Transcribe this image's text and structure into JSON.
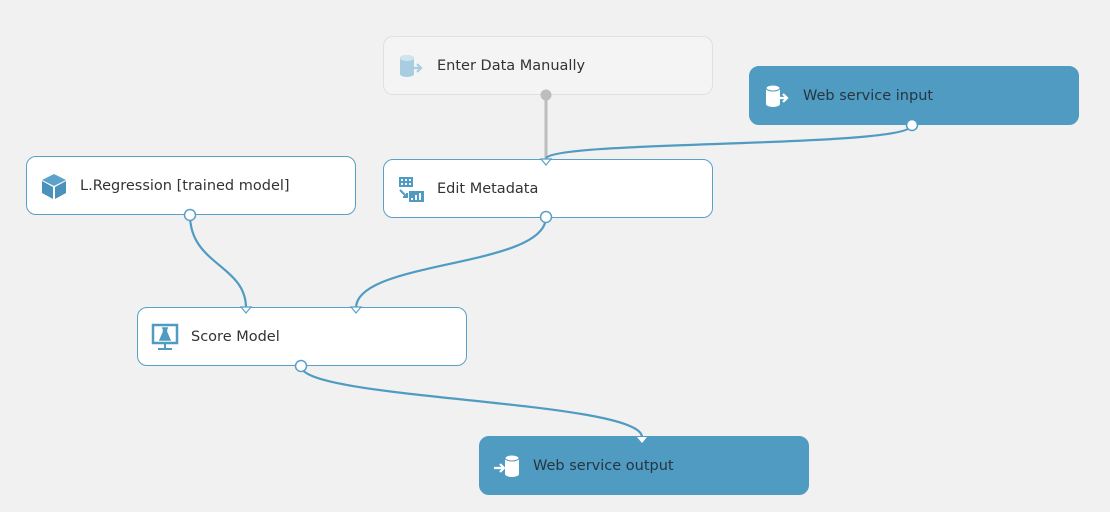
{
  "canvas": {
    "background": "#f1f1f1",
    "accent": "#4f9bc2"
  },
  "nodes": [
    {
      "id": "enter-data",
      "label": "Enter Data Manually",
      "icon": "database-export-icon",
      "style": "disabled"
    },
    {
      "id": "web-service-input",
      "label": "Web service input",
      "icon": "database-export-icon",
      "style": "webservice"
    },
    {
      "id": "lregression",
      "label": "L.Regression [trained model]",
      "icon": "cube-icon",
      "style": "normal"
    },
    {
      "id": "edit-metadata",
      "label": "Edit Metadata",
      "icon": "edit-metadata-icon",
      "style": "normal"
    },
    {
      "id": "score-model",
      "label": "Score Model",
      "icon": "score-model-icon",
      "style": "normal"
    },
    {
      "id": "web-service-output",
      "label": "Web service output",
      "icon": "database-import-icon",
      "style": "webservice"
    }
  ],
  "connections": [
    {
      "from": "enter-data",
      "to": "edit-metadata",
      "state": "disabled"
    },
    {
      "from": "web-service-input",
      "to": "edit-metadata",
      "state": "active"
    },
    {
      "from": "lregression",
      "to": "score-model",
      "state": "active"
    },
    {
      "from": "edit-metadata",
      "to": "score-model",
      "state": "active"
    },
    {
      "from": "score-model",
      "to": "web-service-output",
      "state": "active"
    }
  ]
}
